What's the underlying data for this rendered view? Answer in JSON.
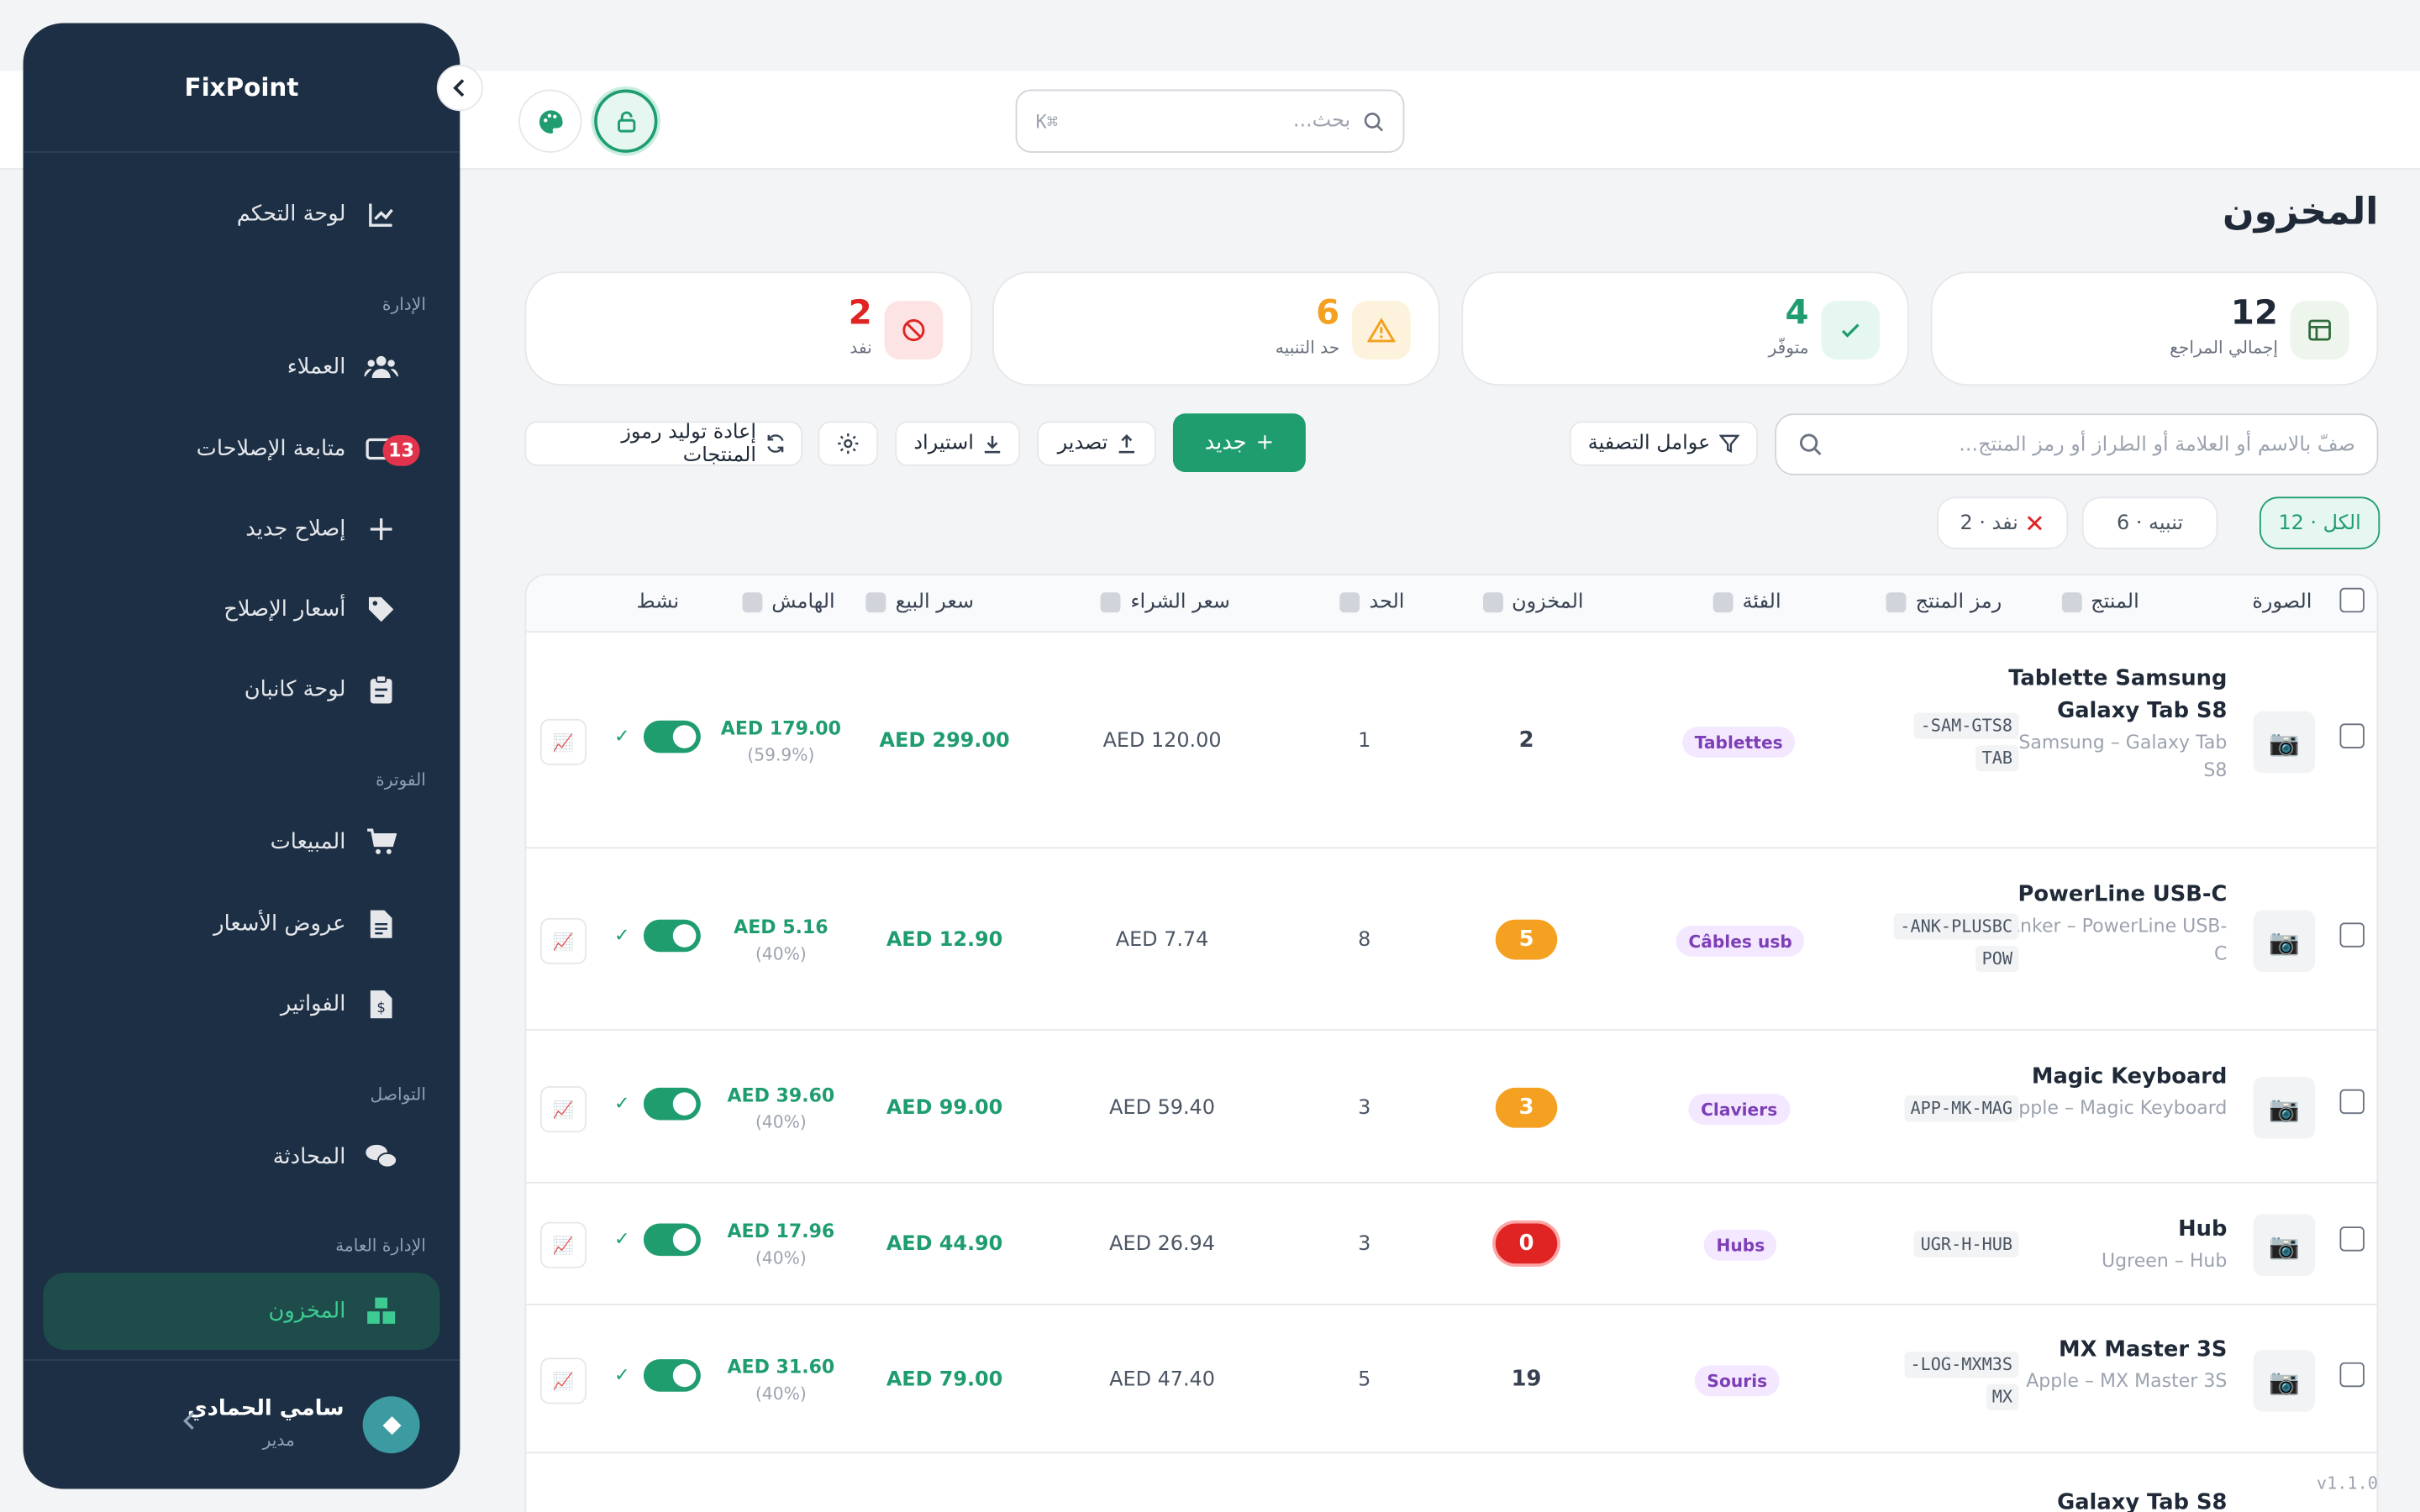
{
  "app": {
    "name": "FixPoint",
    "version": "v1.1.0"
  },
  "topbar": {
    "search_placeholder": "بحث...",
    "shortcut": "K⌘"
  },
  "sidebar": {
    "items": {
      "dashboard": "لوحة التحكم",
      "customers": "العملاء",
      "repairs_tracking": "متابعة الإصلاحات",
      "new_repair": "إصلاح جديد",
      "repair_prices": "أسعار الإصلاح",
      "kanban": "لوحة كانبان",
      "sales": "المبيعات",
      "quotes": "عروض الأسعار",
      "invoices": "الفواتير",
      "chat": "المحادثة",
      "inventory": "المخزون"
    },
    "sections": {
      "management": "الإدارة",
      "billing": "الفوترة",
      "communication": "التواصل",
      "general_admin": "الإدارة العامة"
    },
    "repairs_badge": "13",
    "user": {
      "name": "سامي الحمادي",
      "role": "مدير"
    }
  },
  "page": {
    "title": "المخزون"
  },
  "stats": [
    {
      "value": "12",
      "label": "إجمالي المراجع",
      "color": "#1f2937"
    },
    {
      "value": "4",
      "label": "متوفّر",
      "color": "#1f9d6f"
    },
    {
      "value": "6",
      "label": "حد التنبيه",
      "color": "#f4a020"
    },
    {
      "value": "2",
      "label": "نفد",
      "color": "#e02424"
    }
  ],
  "toolbar": {
    "search_placeholder": "صفّ بالاسم أو العلامة أو الطراز أو رمز المنتج...",
    "filters": "عوامل التصفية",
    "new": "جديد",
    "export": "تصدير",
    "import": "استيراد",
    "regenerate": "إعادة توليد رموز المنتجات"
  },
  "chips": {
    "all": "الكل · 12",
    "warning": "تنبيه · 6",
    "out": "نفد · 2"
  },
  "table": {
    "headers": {
      "image": "الصورة",
      "product": "المنتج",
      "sku": "رمز المنتج",
      "category": "الفئة",
      "stock": "المخزون",
      "limit": "الحد",
      "buy_price": "سعر الشراء",
      "sell_price": "سعر البيع",
      "margin": "الهامش",
      "active": "نشط"
    },
    "rows": [
      {
        "name": "Tablette Samsung Galaxy Tab S8",
        "sub": "Samsung – Galaxy Tab S8",
        "sku1": "SAM-GTS8-",
        "sku2": "TAB",
        "category": "Tablettes",
        "stock": "2",
        "limit": "1",
        "buy": "AED 120.00",
        "sell": "AED 299.00",
        "margin": "AED 179.00",
        "margin_pct": "(59.9%)"
      },
      {
        "name": "PowerLine USB-C",
        "sub": "Anker – PowerLine USB-C",
        "sku1": "ANK-PLUSBC-",
        "sku2": "POW",
        "category": "Câbles usb",
        "stock": "5",
        "limit": "8",
        "buy": "AED 7.74",
        "sell": "AED 12.90",
        "margin": "AED 5.16",
        "margin_pct": "(40%)"
      },
      {
        "name": "Magic Keyboard",
        "sub": "Apple – Magic Keyboard",
        "sku1": "APP-MK-MAG",
        "sku2": "",
        "category": "Claviers",
        "stock": "3",
        "limit": "3",
        "buy": "AED 59.40",
        "sell": "AED 99.00",
        "margin": "AED 39.60",
        "margin_pct": "(40%)"
      },
      {
        "name": "Hub",
        "sub": "Ugreen – Hub",
        "sku1": "UGR-H-HUB",
        "sku2": "",
        "category": "Hubs",
        "stock": "0",
        "limit": "3",
        "buy": "AED 26.94",
        "sell": "AED 44.90",
        "margin": "AED 17.96",
        "margin_pct": "(40%)"
      },
      {
        "name": "MX Master 3S",
        "sub": "Apple – MX Master 3S",
        "sku1": "LOG-MXM3S-",
        "sku2": "MX",
        "category": "Souris",
        "stock": "19",
        "limit": "5",
        "buy": "AED 47.40",
        "sell": "AED 79.00",
        "margin": "AED 31.60",
        "margin_pct": "(40%)"
      },
      {
        "name": "Galaxy Tab S8",
        "sub": "",
        "sku1": "",
        "sku2": "",
        "category": "",
        "stock": "",
        "limit": "",
        "buy": "",
        "sell": "",
        "margin": "",
        "margin_pct": ""
      }
    ]
  }
}
